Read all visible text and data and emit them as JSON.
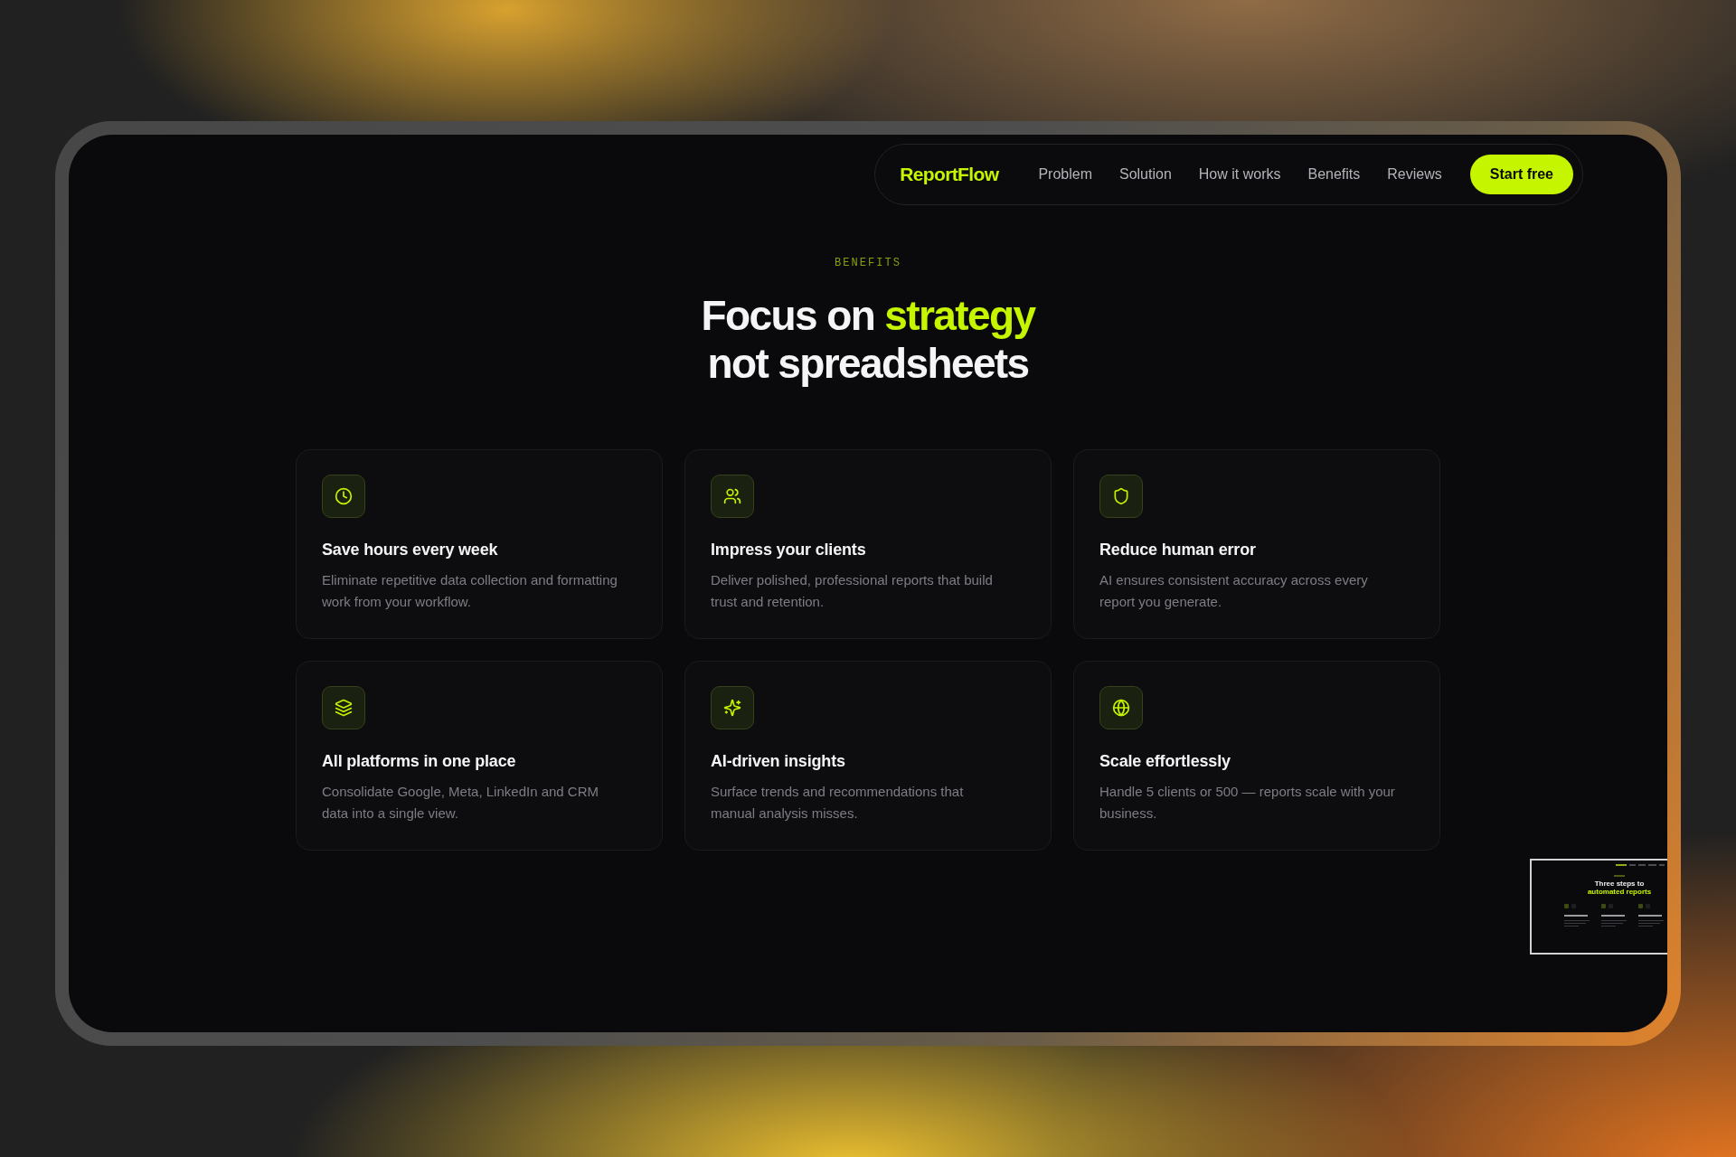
{
  "nav": {
    "logo": "ReportFlow",
    "links": [
      "Problem",
      "Solution",
      "How it works",
      "Benefits",
      "Reviews"
    ],
    "cta": "Start free"
  },
  "benefits": {
    "eyebrow": "BENEFITS",
    "heading_lines": [
      [
        {
          "text": "Focus on",
          "highlight": false
        },
        {
          "text": "strategy",
          "highlight": true
        }
      ],
      [
        {
          "text": "not spreadsheets",
          "highlight": false
        }
      ]
    ],
    "cards": [
      {
        "title": "Save hours every week",
        "description": "Eliminate repetitive data collection and formatting work from your workflow."
      },
      {
        "title": "Impress your clients",
        "description": "Deliver polished, professional reports that build trust and retention."
      },
      {
        "title": "Reduce human error",
        "description": "AI ensures consistent accuracy across every report you generate."
      },
      {
        "title": "All platforms in one place",
        "description": "Consolidate Google, Meta, LinkedIn and CRM data into a single view."
      },
      {
        "title": "AI-driven insights",
        "description": "Surface trends and recommendations that manual analysis misses."
      },
      {
        "title": "Scale effortlessly",
        "description": "Handle 5 clients or 500 — reports scale with your business."
      }
    ]
  },
  "preview": {
    "heading_lines": [
      {
        "text": "Three steps to",
        "highlight": false
      },
      {
        "text": "automated reports",
        "highlight": true
      }
    ]
  }
}
